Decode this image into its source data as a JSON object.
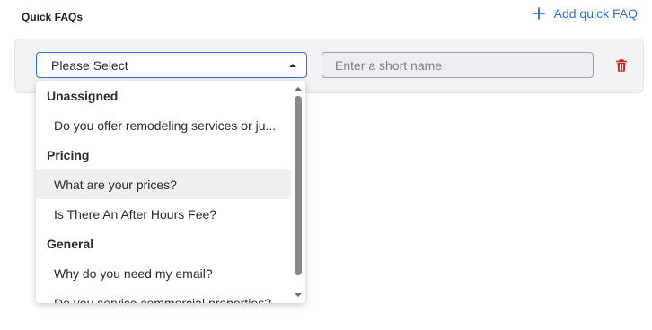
{
  "header": {
    "title": "Quick FAQs",
    "add_label": "Add quick FAQ"
  },
  "row": {
    "select_value": "Please Select",
    "short_name_placeholder": "Enter a short name"
  },
  "dropdown": {
    "items": [
      {
        "kind": "group",
        "label": "Unassigned"
      },
      {
        "kind": "option",
        "label": "Do you offer remodeling services or ju..."
      },
      {
        "kind": "group",
        "label": "Pricing"
      },
      {
        "kind": "option",
        "label": "What are your prices?",
        "hovered": true
      },
      {
        "kind": "option",
        "label": "Is There An After Hours Fee?"
      },
      {
        "kind": "group",
        "label": "General"
      },
      {
        "kind": "option",
        "label": "Why do you need my email?"
      },
      {
        "kind": "option",
        "label": "Do you service commercial properties?"
      }
    ]
  },
  "icons": {
    "add": "plus-icon",
    "caret": "caret-up-icon",
    "delete": "trash-icon"
  },
  "colors": {
    "accent": "#2e6fd8",
    "danger": "#cc1f1a",
    "row_bg": "#f2f3f5",
    "hover_bg": "#efefef"
  }
}
